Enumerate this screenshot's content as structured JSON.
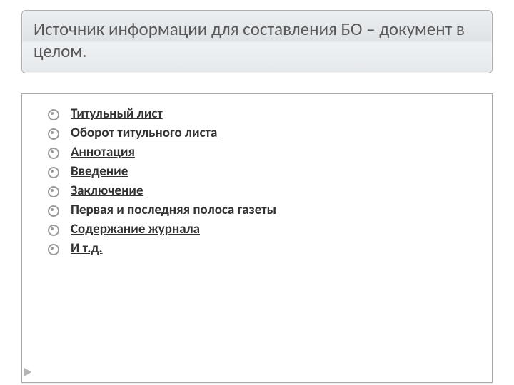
{
  "title": "Источник информации для составления БО – документ в целом.",
  "bullets": [
    "Титульный лист",
    "Оборот титульного листа",
    "Аннотация",
    "Введение",
    "Заключение",
    "Первая и последняя полоса газеты",
    "Содержание журнала",
    "И т.д."
  ]
}
